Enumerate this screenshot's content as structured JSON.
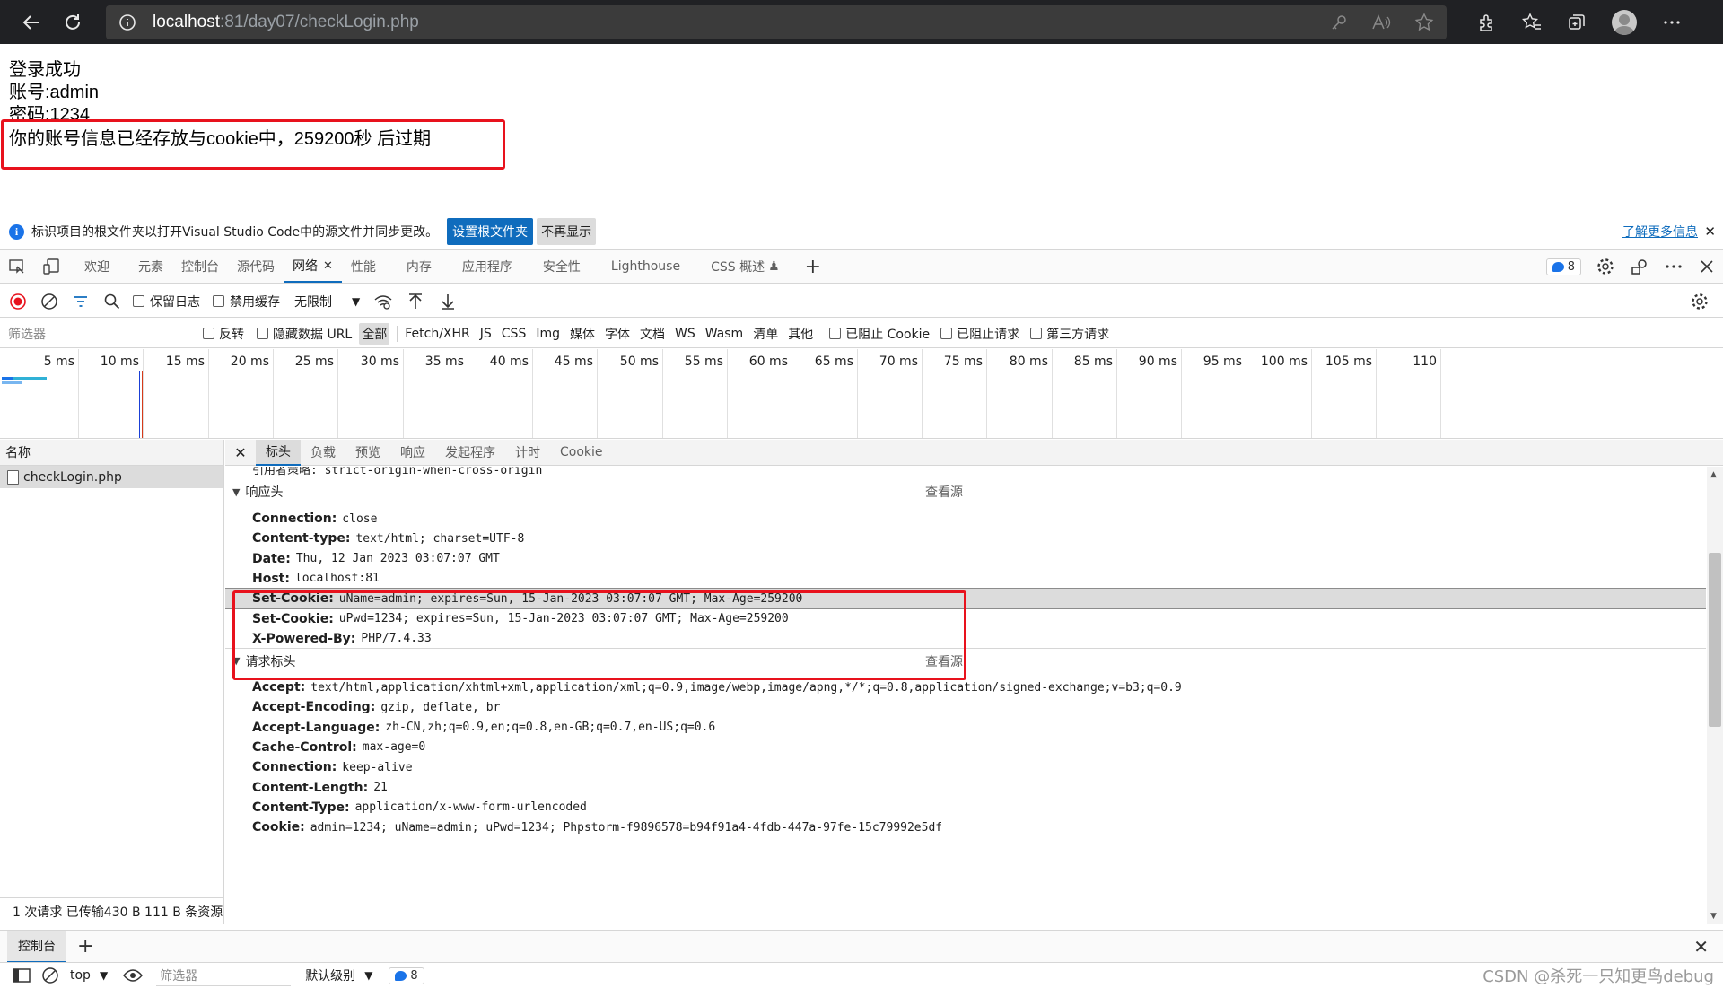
{
  "browser": {
    "url_host": "localhost",
    "url_path": ":81/day07/checkLogin.php"
  },
  "page": {
    "line1": "登录成功",
    "line2": "账号:admin",
    "line3": "密码:1234",
    "line4": "你的账号信息已经存放与cookie中，259200秒 后过期"
  },
  "info_bar": {
    "message": "标识项目的根文件夹以打开Visual Studio Code中的源文件并同步更改。",
    "primary_button": "设置根文件夹",
    "secondary_button": "不再显示",
    "learn_more": "了解更多信息"
  },
  "devtools": {
    "tabs": [
      "欢迎",
      "元素",
      "控制台",
      "源代码",
      "网络",
      "性能",
      "内存",
      "应用程序",
      "安全性",
      "Lighthouse",
      "CSS 概述"
    ],
    "active_tab": "网络",
    "issues_count": "8"
  },
  "network_toolbar": {
    "preserve_log": "保留日志",
    "disable_cache": "禁用缓存",
    "throttle": "无限制"
  },
  "filter_row": {
    "placeholder": "筛选器",
    "invert": "反转",
    "hide_data_urls": "隐藏数据 URL",
    "types": [
      "全部",
      "Fetch/XHR",
      "JS",
      "CSS",
      "Img",
      "媒体",
      "字体",
      "文档",
      "WS",
      "Wasm",
      "清单",
      "其他"
    ],
    "blocked_cookies": "已阻止 Cookie",
    "blocked_requests": "已阻止请求",
    "third_party": "第三方请求"
  },
  "timeline": {
    "ticks": [
      "5 ms",
      "10 ms",
      "15 ms",
      "20 ms",
      "25 ms",
      "30 ms",
      "35 ms",
      "40 ms",
      "45 ms",
      "50 ms",
      "55 ms",
      "60 ms",
      "65 ms",
      "70 ms",
      "75 ms",
      "80 ms",
      "85 ms",
      "90 ms",
      "95 ms",
      "100 ms",
      "105 ms",
      "110"
    ]
  },
  "request_list": {
    "header": "名称",
    "item": "checkLogin.php",
    "status": "1 次请求  已传输430 B  111 B 条资源"
  },
  "details": {
    "tabs": [
      "标头",
      "负载",
      "预览",
      "响应",
      "发起程序",
      "计时",
      "Cookie"
    ],
    "active_tab": "标头",
    "referrer_row": "引用者策略: strict-origin-when-cross-origin",
    "view_source": "查看源",
    "response_section": "响应头",
    "response_headers": [
      {
        "name": "Connection:",
        "value": "close"
      },
      {
        "name": "Content-type:",
        "value": "text/html; charset=UTF-8"
      },
      {
        "name": "Date:",
        "value": "Thu, 12 Jan 2023 03:07:07 GMT"
      },
      {
        "name": "Host:",
        "value": "localhost:81"
      },
      {
        "name": "Set-Cookie:",
        "value": "uName=admin; expires=Sun, 15-Jan-2023 03:07:07 GMT; Max-Age=259200"
      },
      {
        "name": "Set-Cookie:",
        "value": "uPwd=1234; expires=Sun, 15-Jan-2023 03:07:07 GMT; Max-Age=259200"
      },
      {
        "name": "X-Powered-By:",
        "value": "PHP/7.4.33"
      }
    ],
    "request_section": "请求标头",
    "request_headers": [
      {
        "name": "Accept:",
        "value": "text/html,application/xhtml+xml,application/xml;q=0.9,image/webp,image/apng,*/*;q=0.8,application/signed-exchange;v=b3;q=0.9"
      },
      {
        "name": "Accept-Encoding:",
        "value": "gzip, deflate, br"
      },
      {
        "name": "Accept-Language:",
        "value": "zh-CN,zh;q=0.9,en;q=0.8,en-GB;q=0.7,en-US;q=0.6"
      },
      {
        "name": "Cache-Control:",
        "value": "max-age=0"
      },
      {
        "name": "Connection:",
        "value": "keep-alive"
      },
      {
        "name": "Content-Length:",
        "value": "21"
      },
      {
        "name": "Content-Type:",
        "value": "application/x-www-form-urlencoded"
      },
      {
        "name": "Cookie:",
        "value": "admin=1234; uName=admin; uPwd=1234; Phpstorm-f9896578=b94f91a4-4fdb-447a-97fe-15c79992e5df"
      }
    ]
  },
  "drawer": {
    "console_tab": "控制台",
    "context": "top",
    "filter_placeholder": "筛选器",
    "level": "默认级别",
    "issues_count": "8"
  },
  "watermark": "CSDN @杀死一只知更鸟debug"
}
